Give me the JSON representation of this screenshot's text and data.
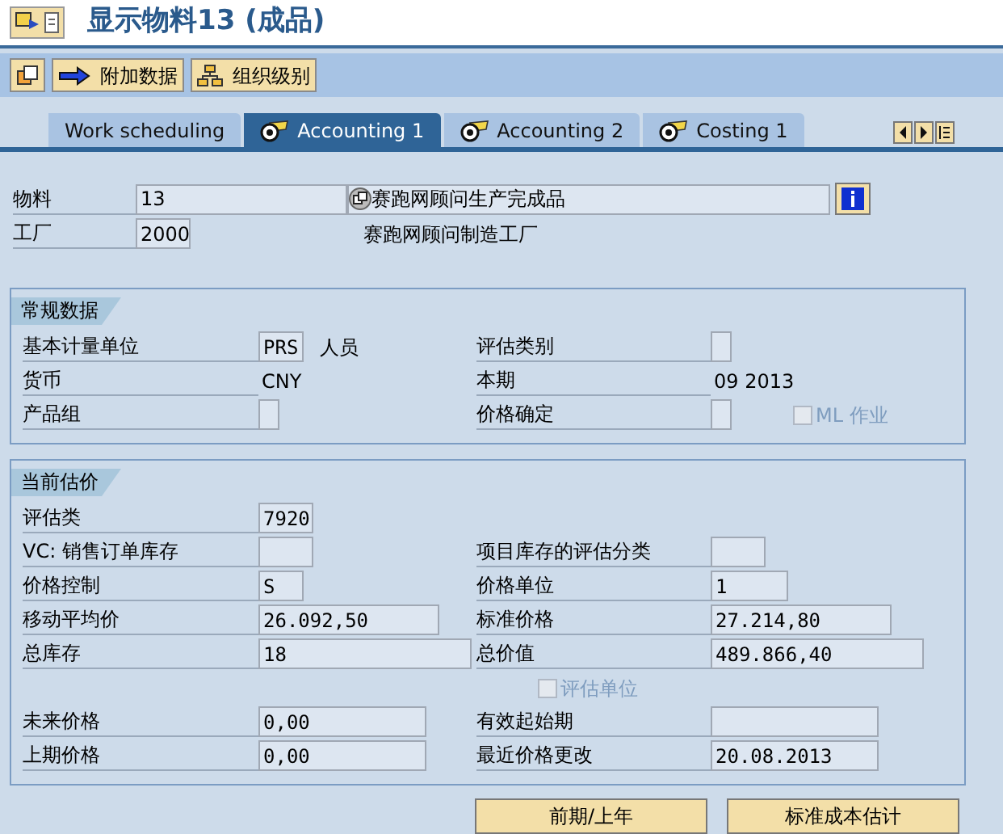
{
  "window": {
    "title": "显示物料13 (成品)"
  },
  "toolbar": {
    "buttons": [
      {
        "kind": "icon"
      },
      {
        "kind": "arrow",
        "label": "附加数据"
      },
      {
        "kind": "tree",
        "label": "组织级别"
      }
    ]
  },
  "tabs": [
    {
      "label": "Work scheduling",
      "selected": false,
      "kind": "plain"
    },
    {
      "label": "Accounting 1",
      "selected": true,
      "kind": "valuation"
    },
    {
      "label": "Accounting 2",
      "selected": false,
      "kind": "valuation"
    },
    {
      "label": "Costing 1",
      "selected": false,
      "kind": "valuation"
    }
  ],
  "header": {
    "material": {
      "label": "物料",
      "value": "13",
      "description": "赛跑网顾问生产完成品"
    },
    "plant": {
      "label": "工厂",
      "value": "2000",
      "description": "赛跑网顾问制造工厂"
    }
  },
  "groups": [
    {
      "title": "常规数据",
      "rows": [
        [
          {
            "label": "基本计量单位",
            "kind": "s",
            "value": "PRS",
            "note": "人员"
          },
          {
            "label": "评估类别",
            "kind": "xs"
          }
        ],
        [
          {
            "label": "货币",
            "kind": "text",
            "value": "CNY"
          },
          {
            "label": "本期",
            "kind": "text",
            "value": "09  2013"
          }
        ],
        [
          {
            "label": "产品组",
            "kind": "xs"
          },
          {
            "label": "价格确定",
            "kind": "xs"
          },
          {
            "label": "ML 作业",
            "kind": "checkbox",
            "checked": false,
            "disabled": true
          }
        ]
      ]
    },
    {
      "title": "当前估价",
      "rows": [
        [
          {
            "label": "评估类",
            "kind": "m",
            "value": "7920"
          }
        ],
        [
          {
            "label": "VC: 销售订单库存",
            "kind": "m"
          },
          {
            "label": "项目库存的评估分类",
            "kind": "m"
          }
        ],
        [
          {
            "label": "价格控制",
            "kind": "s",
            "value": "S"
          },
          {
            "label": "价格单位",
            "kind": "l",
            "value": "1"
          }
        ],
        [
          {
            "label": "移动平均价",
            "kind": "xl",
            "value": "26.092,50"
          },
          {
            "label": "标准价格",
            "kind": "xl",
            "value": "27.214,80"
          }
        ],
        [
          {
            "label": "总库存",
            "kind": "xxl",
            "value": "18"
          },
          {
            "label": "总价值",
            "kind": "xxl",
            "value": "489.866,40"
          }
        ],
        [
          {
            "kind": "blank"
          },
          {
            "label": "评估单位",
            "kind": "checkbox",
            "checked": false,
            "disabled": true
          }
        ],
        [
          {
            "label": "未来价格",
            "kind": "wl",
            "value": "0,00"
          },
          {
            "label": "有效起始期",
            "kind": "wl"
          }
        ],
        [
          {
            "label": "上期价格",
            "kind": "wl",
            "value": "0,00"
          },
          {
            "label": "最近价格更改",
            "kind": "wl",
            "value": "20.08.2013"
          }
        ]
      ]
    }
  ],
  "buttons": [
    "前期/上年",
    "标准成本估计"
  ]
}
